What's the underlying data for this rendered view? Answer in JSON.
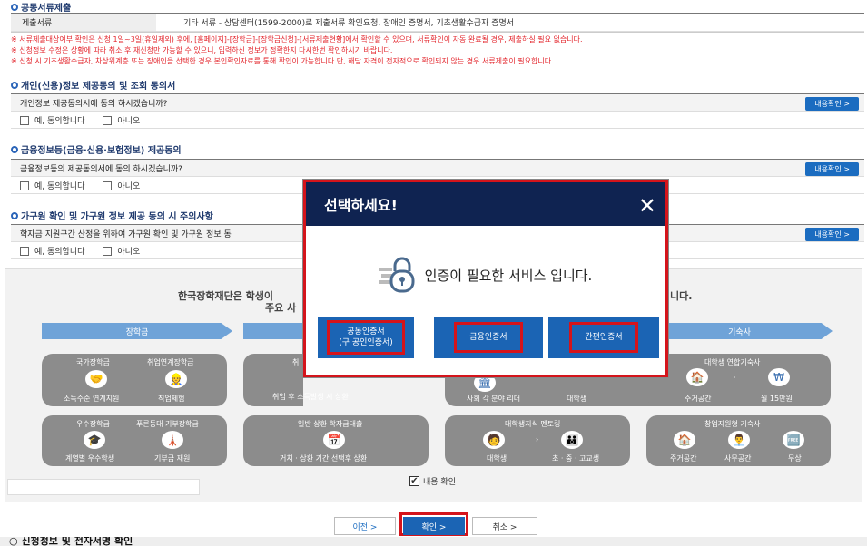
{
  "sections": {
    "doc_title": "공동서류제출",
    "personal_title": "개인(신용)정보 제공동의 및 조회 동의서",
    "finance_title": "금융정보등(금융·신용·보험정보) 제공동의",
    "household_title": "가구원 확인 및 가구원 정보 제공 동의 시 주의사항",
    "next_title": "신청정보 및 전자서명 확인"
  },
  "doc_table": {
    "label": "제출서류",
    "value": "기타 서류 - 상담센터(1599-2000)로 제출서류 확인요청, 장애인 증명서, 기초생활수급자 증명서"
  },
  "notes": [
    "※ 서류제출대상여부 확인은 신청 1일~3일(휴일제외) 후에, [홈페이지]-[장학금]-[장학금신청]-[서류제출현황]에서 확인할 수 있으며, 서류확인이 자동 완료될 경우, 제출하실 필요 없습니다.",
    "※ 신청정보 수정은 상황에 따라 취소 후 재신청만 가능할 수 있으니, 입력하신 정보가 정확한지 다시한번 확인하시기 바랍니다.",
    "※ 신청 시 기초생활수급자, 차상위계층 또는 장애인을 선택한 경우 본인확인자료를 통해 확인이 가능합니다.단, 해당 자격이 전자적으로 확인되지 않는 경우 서류제출이 필요합니다."
  ],
  "questions": {
    "personal": "개인정보 제공동의서에 동의 하시겠습니까?",
    "finance": "금융정보등의 제공동의서에 동의 하시겠습니까?",
    "household": "학자금 지원구간 산정을 위하여 가구원 확인 및 가구원 정보 동"
  },
  "detail_btn": "내용확인 >",
  "yes_label": "예, 동의합니다",
  "no_label": "아니오",
  "panel": {
    "intro_left": "한국장학재단은 학생이",
    "intro_right": "니다.",
    "intro_line2": "주요 사",
    "bar1": "장학금",
    "bar4": "기숙사",
    "check_label": "내용 확인",
    "g1": {
      "a": "국가장학금",
      "b": "취업연계장학금",
      "c": "소득수준 연계지원",
      "d": "직업체험"
    },
    "g2": {
      "a": "취",
      "c": "취업 후 소득발생 시 상환"
    },
    "g3": {
      "c": "사회 각 분야 리더",
      "d": "대학생"
    },
    "g4": {
      "a": "대학생 연합기숙사",
      "c": "주거공간",
      "d": "월 15만원"
    },
    "g5": {
      "a": "우수장학금",
      "b": "푸른등대 기부장학금",
      "c": "계열별 우수학생",
      "d": "기부금 재원"
    },
    "g6": {
      "a": "일반 상환 학자금대출",
      "c": "거치 · 상환 기간 선택후 상환"
    },
    "g7": {
      "a": "대학생지식 멘토링",
      "c": "대학생",
      "d": "초 · 중 · 고교생"
    },
    "g8": {
      "a": "창업지원형 기숙사",
      "c": "주거공간",
      "d": "사무공간",
      "e": "무상"
    }
  },
  "modal": {
    "title": "선택하세요!",
    "message": "인증이 필요한 서비스 입니다.",
    "btn1_line1": "공동인증서",
    "btn1_line2": "(구 공인인증서)",
    "btn2": "금융인증서",
    "btn3": "간편인증서"
  },
  "footer": {
    "prev": "이전 >",
    "confirm": "확인 >",
    "cancel": "취소 >"
  },
  "colors": {
    "accent": "#1b6cc0",
    "modal_header": "#0f2351",
    "highlight": "#d4141b",
    "note": "#e3242b"
  }
}
